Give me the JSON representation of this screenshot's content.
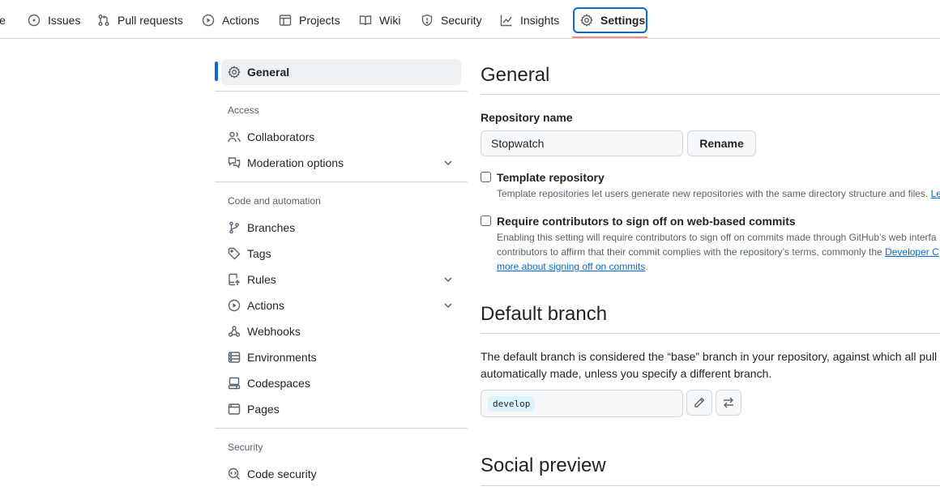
{
  "nav": {
    "tabs": [
      {
        "label": "le",
        "icon": "code-icon"
      },
      {
        "label": "Issues",
        "icon": "issue-opened-icon"
      },
      {
        "label": "Pull requests",
        "icon": "git-pull-request-icon"
      },
      {
        "label": "Actions",
        "icon": "play-icon"
      },
      {
        "label": "Projects",
        "icon": "table-icon"
      },
      {
        "label": "Wiki",
        "icon": "book-icon"
      },
      {
        "label": "Security",
        "icon": "shield-icon"
      },
      {
        "label": "Insights",
        "icon": "graph-icon"
      },
      {
        "label": "Settings",
        "icon": "gear-icon",
        "selected": true
      }
    ]
  },
  "sidebar": {
    "general": "General",
    "access_heading": "Access",
    "collaborators": "Collaborators",
    "moderation": "Moderation options",
    "code_heading": "Code and automation",
    "branches": "Branches",
    "tags": "Tags",
    "rules": "Rules",
    "actions": "Actions",
    "webhooks": "Webhooks",
    "environments": "Environments",
    "codespaces": "Codespaces",
    "pages": "Pages",
    "security_heading": "Security",
    "code_security": "Code security"
  },
  "main": {
    "general_title": "General",
    "repo_name_label": "Repository name",
    "repo_name_value": "Stopwatch",
    "rename_button": "Rename",
    "template": {
      "label": "Template repository",
      "description": "Template repositories let users generate new repositories with the same directory structure and files.",
      "link": "Lea",
      "checked": false
    },
    "signoff": {
      "label": "Require contributors to sign off on web-based commits",
      "line1": "Enabling this setting will require contributors to sign off on commits made through GitHub’s web interfa",
      "line2_text": "contributors to affirm that their commit complies with the repository’s terms, commonly the ",
      "line2_link": "Developer C",
      "line3_link": "more about signing off on commits",
      "line3_end": ".",
      "checked": false
    },
    "default_branch_title": "Default branch",
    "default_branch_line1": "The default branch is considered the “base” branch in your repository, against which all pull",
    "default_branch_line2": "automatically made, unless you specify a different branch.",
    "default_branch_value": "develop",
    "social_preview_title": "Social preview"
  },
  "colors": {
    "accent": "#0969da",
    "underline": "#fd8c73",
    "border": "#d1d9e0",
    "muted": "#59636e"
  }
}
